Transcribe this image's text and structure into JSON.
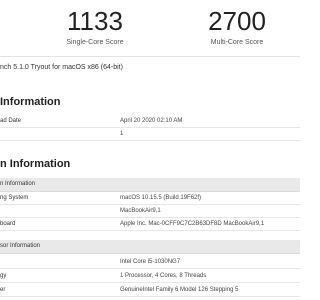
{
  "scores": {
    "single_value": "1133",
    "single_label": "Single-Core Score",
    "multi_value": "2700",
    "multi_label": "Multi-Core Score"
  },
  "version_line": "nch 5.1.0 Tryout for macOS x86 (64-bit)",
  "result_info": {
    "title": "Information",
    "rows": [
      {
        "key": "ad Date",
        "value": "April 20 2020 02:10 AM"
      },
      {
        "key": "",
        "value": "1"
      }
    ]
  },
  "system_info": {
    "title": "n Information",
    "subheader": "n Information",
    "rows": [
      {
        "key": "ng System",
        "value": "macOS 10.15.5 (Build 19F62f)"
      },
      {
        "key": "",
        "value": "MacBookAir9,1"
      },
      {
        "key": "board",
        "value": "Apple Inc. Mac-0CFF9C7C2B63DF8D MacBookAir9,1"
      }
    ],
    "processor_subheader": "sor Information",
    "processor_rows": [
      {
        "key": "",
        "value": "Intel Core i5-1030NG7"
      },
      {
        "key": "gy",
        "value": "1 Processor, 4 Cores, 8 Threads"
      },
      {
        "key": "er",
        "value": "GenuineIntel Family 6 Model 126 Stepping 5"
      }
    ]
  }
}
